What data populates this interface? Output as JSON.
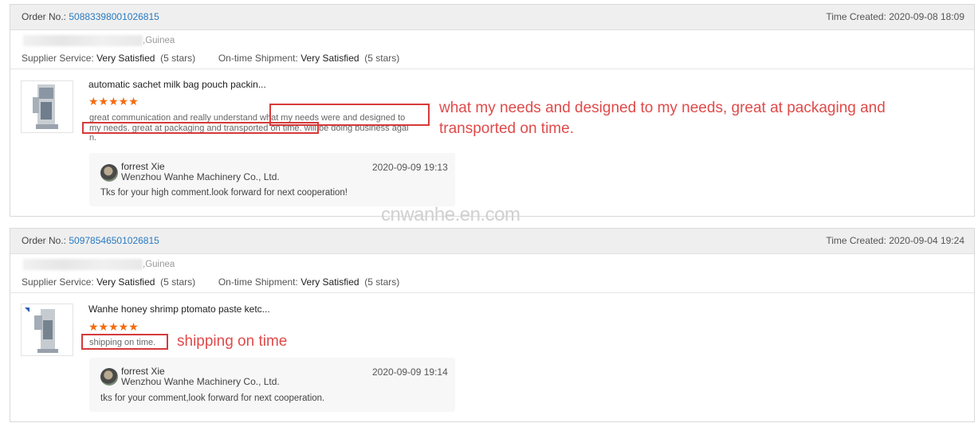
{
  "orders": [
    {
      "order_label": "Order No.:",
      "order_no": "50883398001026815",
      "time_created": "Time Created: 2020-09-08 18:09",
      "buyer_country": ",Guinea",
      "supplier_service_label": "Supplier Service:",
      "supplier_service_value": "Very Satisfied",
      "supplier_service_stars": "(5 stars)",
      "shipment_label": "On-time Shipment:",
      "shipment_value": "Very Satisfied",
      "shipment_stars": "(5 stars)",
      "product_title": "automatic sachet milk bag pouch packin...",
      "rating_stars": "★★★★★",
      "review_line1": "great communication and really understand what my needs were and designed to",
      "review_line2": "my needs. great at packaging and transported on time. will be doing business agai",
      "review_line3": "n.",
      "reply": {
        "name": "forrest Xie",
        "company": "Wenzhou Wanhe Machinery Co., Ltd.",
        "date": "2020-09-09 19:13",
        "message": "Tks for your high comment.look forward for next cooperation!"
      },
      "annotation": "what my needs and designed to my needs, great at packaging and transported on time."
    },
    {
      "order_label": "Order No.:",
      "order_no": "50978546501026815",
      "time_created": "Time Created: 2020-09-04 19:24",
      "buyer_country": ",Guinea",
      "supplier_service_label": "Supplier Service:",
      "supplier_service_value": "Very Satisfied",
      "supplier_service_stars": "(5 stars)",
      "shipment_label": "On-time Shipment:",
      "shipment_value": "Very Satisfied",
      "shipment_stars": "(5 stars)",
      "product_title": "Wanhe honey shrimp ptomato paste ketc...",
      "rating_stars": "★★★★★",
      "review_line1": "shipping on time.",
      "reply": {
        "name": "forrest Xie",
        "company": "Wenzhou Wanhe Machinery Co., Ltd.",
        "date": "2020-09-09 19:14",
        "message": "tks for your comment,look forward for next cooperation."
      },
      "annotation": "shipping on time"
    }
  ],
  "watermark": "cnwanhe.en.com",
  "colors": {
    "link": "#2a7ac0",
    "stars": "#f46b10",
    "annotation": "#d63a3a"
  }
}
